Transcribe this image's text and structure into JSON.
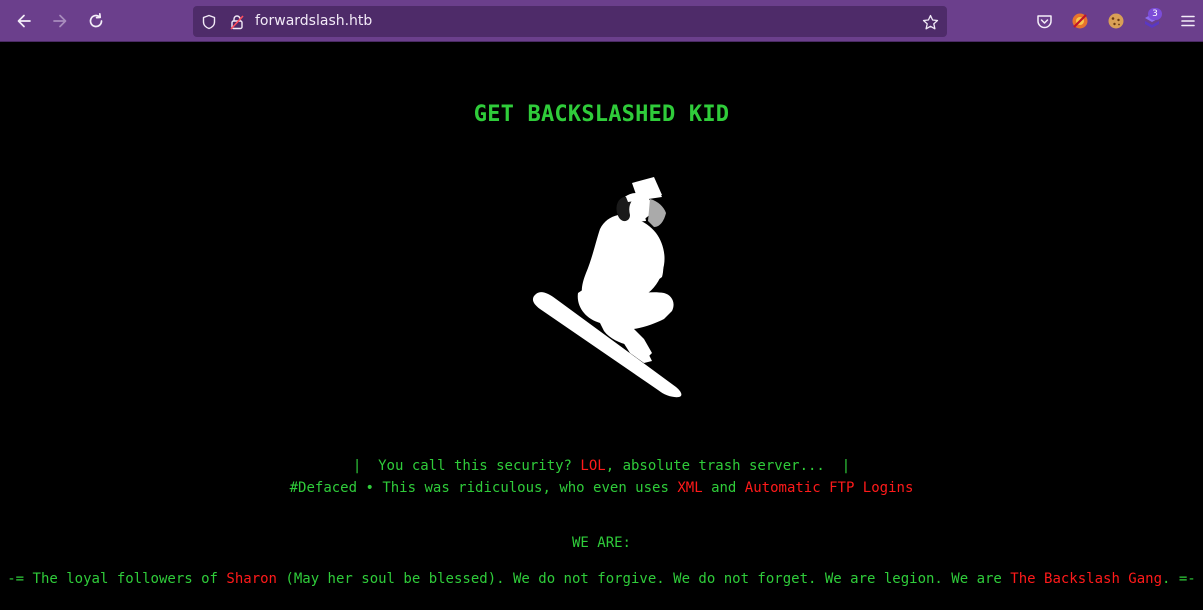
{
  "browser": {
    "url": "forwardslash.htb",
    "extension_badge_count": "3",
    "icons": {
      "back": "back-arrow-icon",
      "forward": "forward-arrow-icon",
      "reload": "reload-icon",
      "shield": "tracking-protection-shield-icon",
      "lock": "insecure-lock-icon",
      "bookmark": "bookmark-star-icon",
      "pocket": "pocket-icon",
      "ext1": "extension-wappalyzer-icon",
      "ext2": "extension-cookie-icon",
      "ext3": "extension-foxyproxy-icon",
      "menu": "hamburger-menu-icon"
    }
  },
  "page": {
    "headline": "GET BACKSLASHED KID",
    "line1": {
      "prefix": "|  You call this security? ",
      "highlight": "LOL",
      "suffix": ", absolute trash server...  |"
    },
    "line2": {
      "prefix": "#Defaced • This was ridiculous, who even uses ",
      "highlight1": "XML",
      "middle": " and ",
      "highlight2": "Automatic FTP Logins"
    },
    "we_are": "WE ARE:",
    "line3": {
      "prefix": "-= The loyal followers of ",
      "highlight1": "Sharon",
      "middle": " (May her soul be blessed). We do not forgive. We do not forget. We are legion. We are ",
      "highlight2": "The Backslash Gang",
      "suffix": ". =-"
    }
  },
  "colors": {
    "toolbar": "#6b3f8c",
    "urlbar": "#4e2b69",
    "page_background": "#000000",
    "text_green": "#2fcc3a",
    "text_red": "#ff1a1a"
  }
}
